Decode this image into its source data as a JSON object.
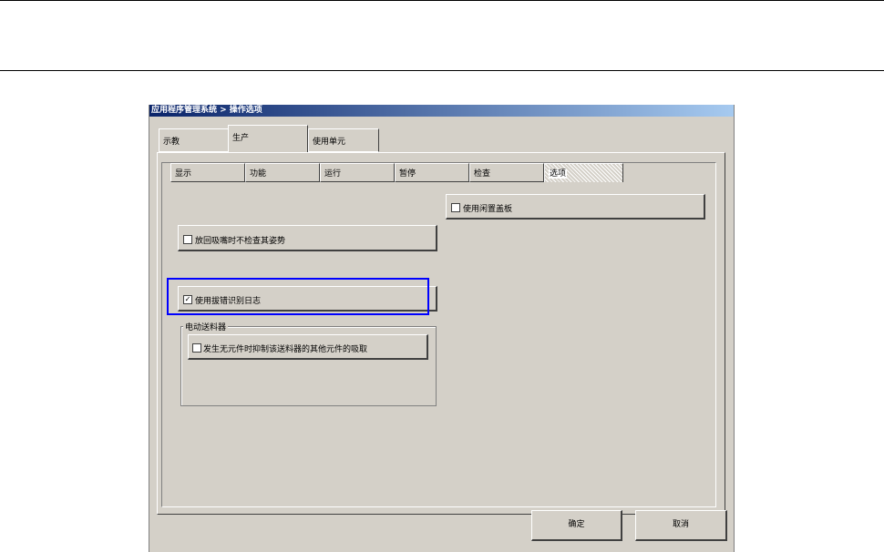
{
  "window": {
    "title": "应用程序管理系统 > 操作选项"
  },
  "main_tabs": [
    {
      "label": "示教"
    },
    {
      "label": "生产"
    },
    {
      "label": "使用单元"
    }
  ],
  "sub_tabs": [
    {
      "label": "显示"
    },
    {
      "label": "功能"
    },
    {
      "label": "运行"
    },
    {
      "label": "暂停"
    },
    {
      "label": "检查"
    },
    {
      "label": "选项"
    }
  ],
  "options": {
    "use_feeder_cover": {
      "label": "使用闲置盖板",
      "checked": false
    },
    "no_check_on_release": {
      "label": "放回吸嘴时不检查其姿势",
      "checked": false
    },
    "use_error_log": {
      "label": "使用拔错识别日志",
      "checked": true
    },
    "feeder_group_label": "电动送料器",
    "suppress_pickup": {
      "label": "发生无元件时抑制该送料器的其他元件的吸取",
      "checked": false
    }
  },
  "buttons": {
    "ok": "确定",
    "cancel": "取消"
  }
}
